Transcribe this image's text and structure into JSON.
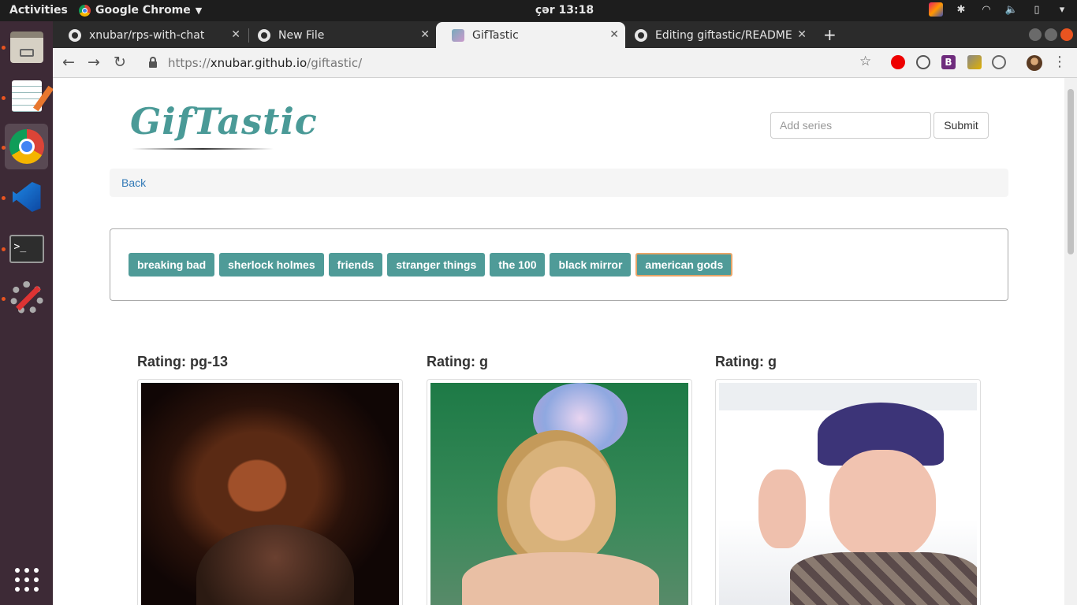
{
  "topbar": {
    "activities": "Activities",
    "app_name": "Google Chrome",
    "clock": "çər 13:18"
  },
  "tabs": [
    {
      "title": "xnubar/rps-with-chat",
      "active": false
    },
    {
      "title": "New File",
      "active": false
    },
    {
      "title": "GifTastic",
      "active": true
    },
    {
      "title": "Editing giftastic/README",
      "active": false
    }
  ],
  "address_bar": {
    "scheme": "https://",
    "host": "xnubar.github.io",
    "path": "/giftastic/"
  },
  "page": {
    "logo": "GifTastic",
    "search": {
      "placeholder": "Add series",
      "value": ""
    },
    "submit_label": "Submit",
    "breadcrumb_back": "Back",
    "series_buttons": [
      "breaking bad",
      "sherlock holmes",
      "friends",
      "stranger things",
      "the 100",
      "black mirror",
      "american gods"
    ],
    "focused_button": "american gods",
    "gifs": [
      {
        "rating": "Rating: pg-13"
      },
      {
        "rating": "Rating: g"
      },
      {
        "rating": "Rating: g"
      }
    ]
  },
  "colors": {
    "accent": "#4f9b98",
    "logo": "#4a9a97",
    "focus_ring": "#e7a468",
    "link": "#337ab7",
    "dock_bg": "#3d2a36"
  },
  "icons": [
    "github-icon",
    "chrome-icon",
    "back-icon",
    "forward-icon",
    "reload-icon",
    "lock-icon",
    "star-icon",
    "menu-icon",
    "files-icon",
    "text-editor-icon",
    "vscode-icon",
    "terminal-icon",
    "settings-icon",
    "app-grid-icon"
  ]
}
